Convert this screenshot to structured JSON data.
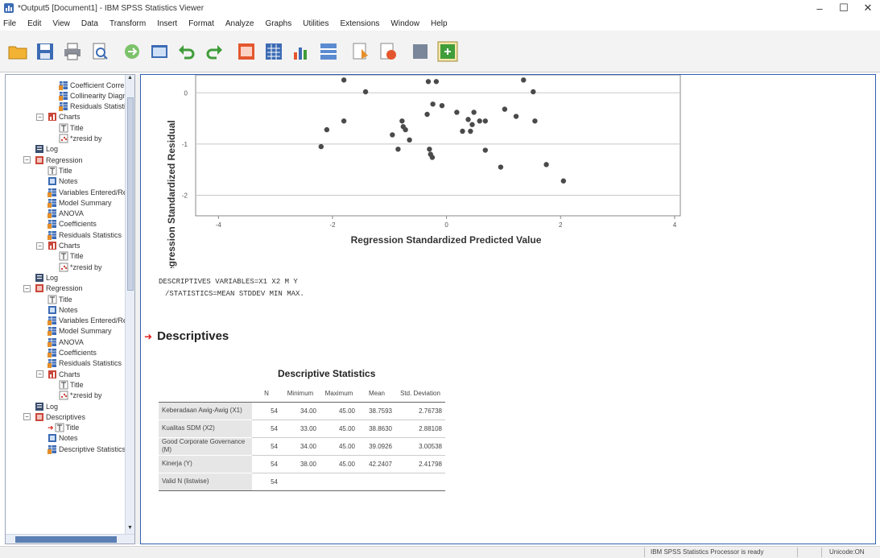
{
  "window": {
    "title": "*Output5 [Document1] - IBM SPSS Statistics Viewer",
    "controls": [
      "–",
      "☐",
      "✕"
    ]
  },
  "menu": [
    "File",
    "Edit",
    "View",
    "Data",
    "Transform",
    "Insert",
    "Format",
    "Analyze",
    "Graphs",
    "Utilities",
    "Extensions",
    "Window",
    "Help"
  ],
  "outline": {
    "items": [
      {
        "label": "Coefficient Correlations",
        "icon": "table-icon",
        "level": 3
      },
      {
        "label": "Collinearity Diagnostics",
        "icon": "table-icon",
        "level": 3
      },
      {
        "label": "Residuals Statistics",
        "icon": "table-icon",
        "level": 3
      },
      {
        "label": "Charts",
        "icon": "chart-folder-icon",
        "level": 2,
        "expander": "−"
      },
      {
        "label": "Title",
        "icon": "title-icon",
        "level": 3
      },
      {
        "label": "*zresid by",
        "icon": "scatter-chart-icon",
        "level": 3
      },
      {
        "label": "Log",
        "icon": "log-icon",
        "level": 1
      },
      {
        "label": "Regression",
        "icon": "procedure-icon",
        "level": 1,
        "expander": "−"
      },
      {
        "label": "Title",
        "icon": "title-icon",
        "level": 2
      },
      {
        "label": "Notes",
        "icon": "notes-icon",
        "level": 2
      },
      {
        "label": "Variables Entered/Removed",
        "icon": "table-icon",
        "level": 2
      },
      {
        "label": "Model Summary",
        "icon": "table-icon",
        "level": 2
      },
      {
        "label": "ANOVA",
        "icon": "table-icon",
        "level": 2
      },
      {
        "label": "Coefficients",
        "icon": "table-icon",
        "level": 2
      },
      {
        "label": "Residuals Statistics",
        "icon": "table-icon",
        "level": 2
      },
      {
        "label": "Charts",
        "icon": "chart-folder-icon",
        "level": 2,
        "expander": "−"
      },
      {
        "label": "Title",
        "icon": "title-icon",
        "level": 3
      },
      {
        "label": "*zresid by",
        "icon": "scatter-chart-icon",
        "level": 3
      },
      {
        "label": "Log",
        "icon": "log-icon",
        "level": 1
      },
      {
        "label": "Regression",
        "icon": "procedure-icon",
        "level": 1,
        "expander": "−"
      },
      {
        "label": "Title",
        "icon": "title-icon",
        "level": 2
      },
      {
        "label": "Notes",
        "icon": "notes-icon",
        "level": 2
      },
      {
        "label": "Variables Entered/Removed",
        "icon": "table-icon",
        "level": 2
      },
      {
        "label": "Model Summary",
        "icon": "table-icon",
        "level": 2
      },
      {
        "label": "ANOVA",
        "icon": "table-icon",
        "level": 2
      },
      {
        "label": "Coefficients",
        "icon": "table-icon",
        "level": 2
      },
      {
        "label": "Residuals Statistics",
        "icon": "table-icon",
        "level": 2
      },
      {
        "label": "Charts",
        "icon": "chart-folder-icon",
        "level": 2,
        "expander": "−"
      },
      {
        "label": "Title",
        "icon": "title-icon",
        "level": 3
      },
      {
        "label": "*zresid by",
        "icon": "scatter-chart-icon",
        "level": 3
      },
      {
        "label": "Log",
        "icon": "log-icon",
        "level": 1
      },
      {
        "label": "Descriptives",
        "icon": "procedure-icon",
        "level": 1,
        "expander": "−"
      },
      {
        "label": "Title",
        "icon": "title-icon",
        "level": 2,
        "selected": true
      },
      {
        "label": "Notes",
        "icon": "notes-icon",
        "level": 2
      },
      {
        "label": "Descriptive Statistics",
        "icon": "table-icon",
        "level": 2
      }
    ]
  },
  "chart_data": {
    "type": "scatter",
    "xlabel": "Regression Standardized Predicted Value",
    "ylabel": "Regression Standardized Residual",
    "xlim": [
      -4.4,
      4.1
    ],
    "ylim": [
      -2.4,
      0.35
    ],
    "x_ticks": [
      -4,
      -2,
      0,
      2,
      4
    ],
    "y_ticks": [
      0,
      -1,
      -2
    ],
    "grid": true,
    "points": [
      {
        "x": -1.8,
        "y": 0.25
      },
      {
        "x": -0.32,
        "y": 0.22
      },
      {
        "x": -0.18,
        "y": 0.22
      },
      {
        "x": 1.35,
        "y": 0.25
      },
      {
        "x": -1.42,
        "y": 0.02
      },
      {
        "x": 1.52,
        "y": 0.02
      },
      {
        "x": -0.24,
        "y": -0.22
      },
      {
        "x": -0.08,
        "y": -0.25
      },
      {
        "x": 1.02,
        "y": -0.32
      },
      {
        "x": -0.34,
        "y": -0.42
      },
      {
        "x": 0.18,
        "y": -0.38
      },
      {
        "x": 0.48,
        "y": -0.38
      },
      {
        "x": 1.22,
        "y": -0.46
      },
      {
        "x": -1.8,
        "y": -0.55
      },
      {
        "x": -0.78,
        "y": -0.55
      },
      {
        "x": 0.38,
        "y": -0.52
      },
      {
        "x": 0.58,
        "y": -0.55
      },
      {
        "x": 0.68,
        "y": -0.55
      },
      {
        "x": 1.55,
        "y": -0.55
      },
      {
        "x": -2.1,
        "y": -0.72
      },
      {
        "x": -0.76,
        "y": -0.66
      },
      {
        "x": -0.72,
        "y": -0.72
      },
      {
        "x": 0.28,
        "y": -0.75
      },
      {
        "x": 0.42,
        "y": -0.75
      },
      {
        "x": 0.45,
        "y": -0.62
      },
      {
        "x": -0.95,
        "y": -0.82
      },
      {
        "x": -0.65,
        "y": -0.92
      },
      {
        "x": -2.2,
        "y": -1.05
      },
      {
        "x": -0.85,
        "y": -1.1
      },
      {
        "x": -0.3,
        "y": -1.1
      },
      {
        "x": 0.68,
        "y": -1.12
      },
      {
        "x": -0.28,
        "y": -1.2
      },
      {
        "x": -0.25,
        "y": -1.26
      },
      {
        "x": 0.95,
        "y": -1.45
      },
      {
        "x": 1.75,
        "y": -1.4
      },
      {
        "x": 2.05,
        "y": -1.72
      }
    ]
  },
  "syntax": {
    "line1": "DESCRIPTIVES VARIABLES=X1 X2 M Y",
    "line2": "/STATISTICS=MEAN STDDEV MIN MAX."
  },
  "descriptives": {
    "heading": "Descriptives",
    "table_title": "Descriptive Statistics",
    "columns": [
      "",
      "N",
      "Minimum",
      "Maximum",
      "Mean",
      "Std. Deviation"
    ],
    "rows": [
      {
        "label": "Keberadaan Awig-Awig (X1)",
        "n": "54",
        "min": "34.00",
        "max": "45.00",
        "mean": "38.7593",
        "sd": "2.76738"
      },
      {
        "label": "Kualitas SDM (X2)",
        "n": "54",
        "min": "33.00",
        "max": "45.00",
        "mean": "38.8630",
        "sd": "2.88108"
      },
      {
        "label": "Good Corporate Governance (M)",
        "n": "54",
        "min": "34.00",
        "max": "45.00",
        "mean": "39.0926",
        "sd": "3.00538"
      },
      {
        "label": "Kinerja (Y)",
        "n": "54",
        "min": "38.00",
        "max": "45.00",
        "mean": "42.2407",
        "sd": "2.41798"
      },
      {
        "label": "Valid N (listwise)",
        "n": "54",
        "min": "",
        "max": "",
        "mean": "",
        "sd": ""
      }
    ]
  },
  "status": {
    "text": "IBM SPSS Statistics Processor is ready",
    "encoding": "Unicode:ON"
  },
  "colors": {
    "accent": "#2f5fb0",
    "point": "#4a4a4a",
    "heading_arrow": "#e0201c"
  }
}
